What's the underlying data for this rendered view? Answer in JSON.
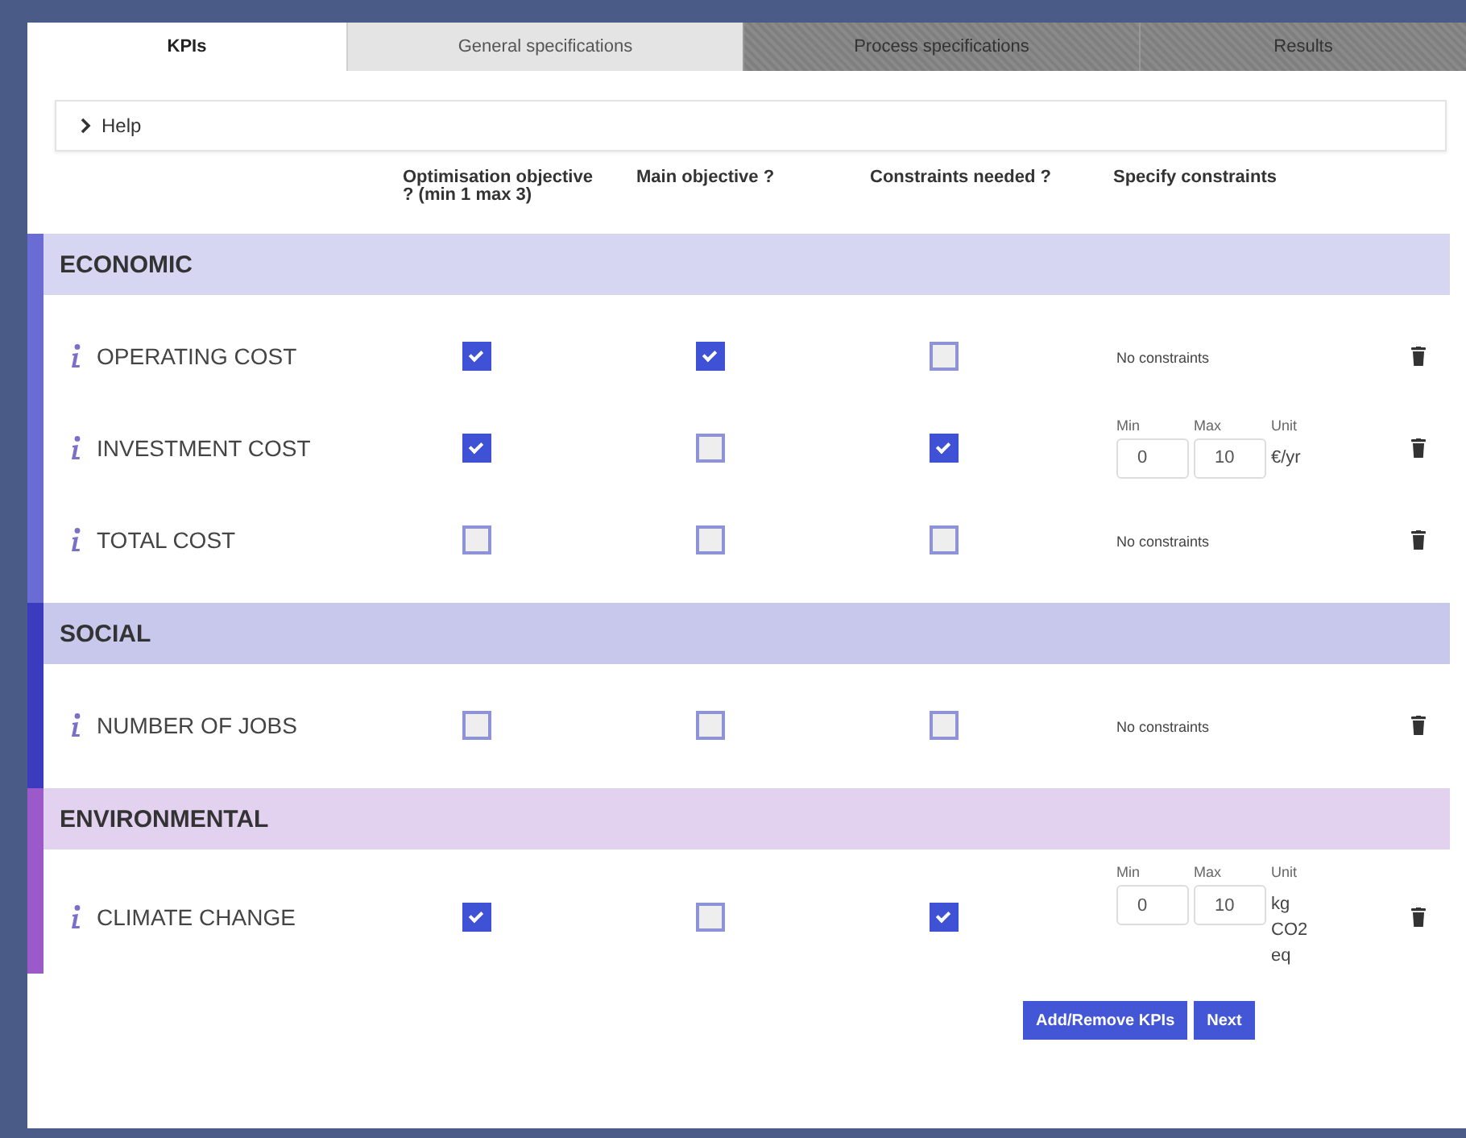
{
  "tabs": [
    {
      "label": "KPIs",
      "selected": true,
      "disabled": false
    },
    {
      "label": "General specifications",
      "selected": false,
      "disabled": false
    },
    {
      "label": "Process specifications",
      "selected": false,
      "disabled": true
    },
    {
      "label": "Results",
      "selected": false,
      "disabled": true
    }
  ],
  "help": {
    "label": "Help",
    "expanded": false
  },
  "columns": [
    "Optimisation objective ? (min 1 max 3)",
    "Main objective ?",
    "Constraints needed ?",
    "Specify constraints"
  ],
  "sections": [
    {
      "title": "ECONOMIC",
      "color": "#6b6bd4",
      "rows": [
        {
          "name": "OPERATING COST",
          "optimisation": true,
          "main": true,
          "constraints": false,
          "constraint": {
            "kind": "none",
            "text": "No constraints"
          }
        },
        {
          "name": "INVESTMENT COST",
          "optimisation": true,
          "main": false,
          "constraints": true,
          "constraint": {
            "kind": "range",
            "min_label": "Min",
            "max_label": "Max",
            "unit_label": "Unit",
            "min": "0",
            "max": "10",
            "unit": "€/yr"
          }
        },
        {
          "name": "TOTAL COST",
          "optimisation": false,
          "main": false,
          "constraints": false,
          "constraint": {
            "kind": "none",
            "text": "No constraints"
          }
        }
      ]
    },
    {
      "title": "SOCIAL",
      "color": "#3b3bbd",
      "rows": [
        {
          "name": "NUMBER OF JOBS",
          "optimisation": false,
          "main": false,
          "constraints": false,
          "constraint": {
            "kind": "none",
            "text": "No constraints"
          }
        }
      ]
    },
    {
      "title": "ENVIRONMENTAL",
      "color": "#9b59c9",
      "rows": [
        {
          "name": "CLIMATE CHANGE",
          "optimisation": true,
          "main": false,
          "constraints": true,
          "constraint": {
            "kind": "range",
            "min_label": "Min",
            "max_label": "Max",
            "unit_label": "Unit",
            "min": "0",
            "max": "10",
            "unit": "kg CO2 eq"
          }
        }
      ]
    }
  ],
  "buttons": [
    "Add/Remove KPIs",
    "Next"
  ]
}
